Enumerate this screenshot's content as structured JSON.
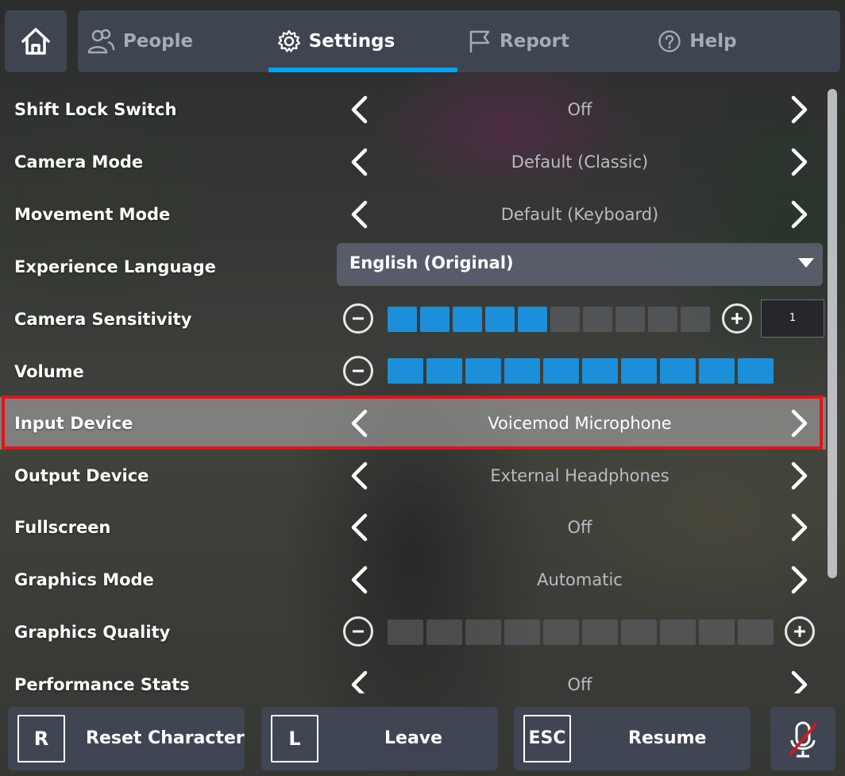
{
  "tabs": [
    {
      "label": "People",
      "icon": "people-icon"
    },
    {
      "label": "Settings",
      "icon": "gear-icon"
    },
    {
      "label": "Report",
      "icon": "flag-icon"
    },
    {
      "label": "Help",
      "icon": "help-icon"
    }
  ],
  "settings": {
    "shift_lock": {
      "label": "Shift Lock Switch",
      "value": "Off"
    },
    "camera_mode": {
      "label": "Camera Mode",
      "value": "Default (Classic)"
    },
    "movement_mode": {
      "label": "Movement Mode",
      "value": "Default (Keyboard)"
    },
    "experience_language": {
      "label": "Experience Language",
      "value": "English (Original)"
    },
    "camera_sensitivity": {
      "label": "Camera Sensitivity",
      "level": 5,
      "max": 10,
      "value_text": "1"
    },
    "volume": {
      "label": "Volume",
      "level": 10,
      "max": 10
    },
    "input_device": {
      "label": "Input Device",
      "value": "Voicemod Microphone"
    },
    "output_device": {
      "label": "Output Device",
      "value": "External Headphones"
    },
    "fullscreen": {
      "label": "Fullscreen",
      "value": "Off"
    },
    "graphics_mode": {
      "label": "Graphics Mode",
      "value": "Automatic"
    },
    "graphics_quality": {
      "label": "Graphics Quality",
      "level": 0,
      "max": 10
    },
    "performance_stats": {
      "label": "Performance Stats",
      "value": "Off"
    }
  },
  "bottom": {
    "reset": {
      "key": "R",
      "label": "Reset Character"
    },
    "leave": {
      "key": "L",
      "label": "Leave"
    },
    "resume": {
      "key": "ESC",
      "label": "Resume"
    }
  },
  "colors": {
    "accent": "#00a2ff",
    "highlight_border": "#e0141b",
    "slider_on": "#1b8fd9"
  }
}
